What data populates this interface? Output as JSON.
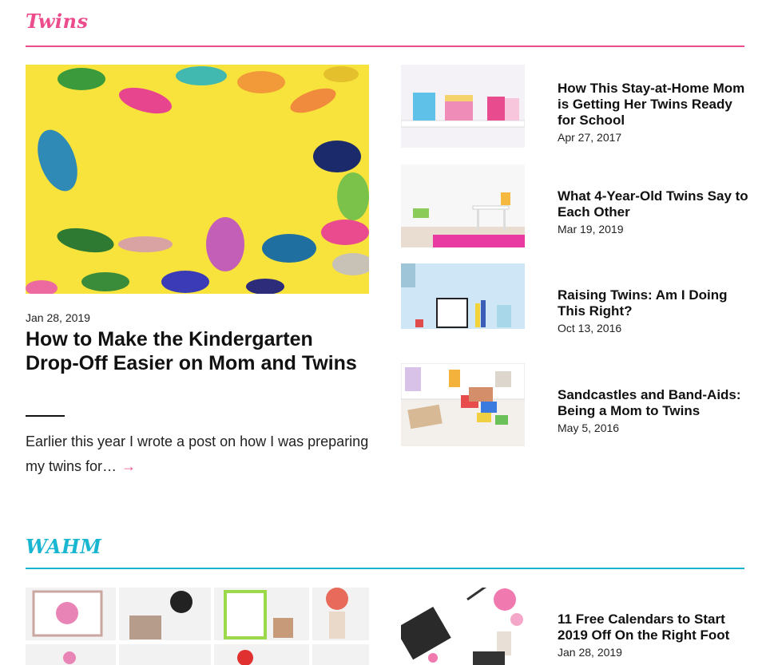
{
  "colors": {
    "twins_accent": "#ec4c8c",
    "wahm_accent": "#19b6d2",
    "text": "#111111"
  },
  "twins": {
    "title": "Twins",
    "featured": {
      "date": "Jan 28, 2019",
      "title": "How to Make the Kindergarten Drop-Off Easier on Mom and Twins",
      "excerpt": "Earlier this year I wrote a post on how I was preparing my twins for…",
      "arrow": "→"
    },
    "posts": [
      {
        "title": "How This Stay-at-Home Mom is Getting Her Twins Ready for School",
        "date": "Apr 27, 2017"
      },
      {
        "title": "What 4-Year-Old Twins Say to Each Other",
        "date": "Mar 19, 2019"
      },
      {
        "title": "Raising Twins: Am I Doing This Right?",
        "date": "Oct 13, 2016"
      },
      {
        "title": "Sandcastles and Band-Aids: Being a Mom to Twins",
        "date": "May 5, 2016"
      }
    ]
  },
  "wahm": {
    "title": "WAHM",
    "posts": [
      {
        "title": "11 Free Calendars to Start 2019 Off On the Right Foot",
        "date": "Jan 28, 2019"
      }
    ]
  }
}
